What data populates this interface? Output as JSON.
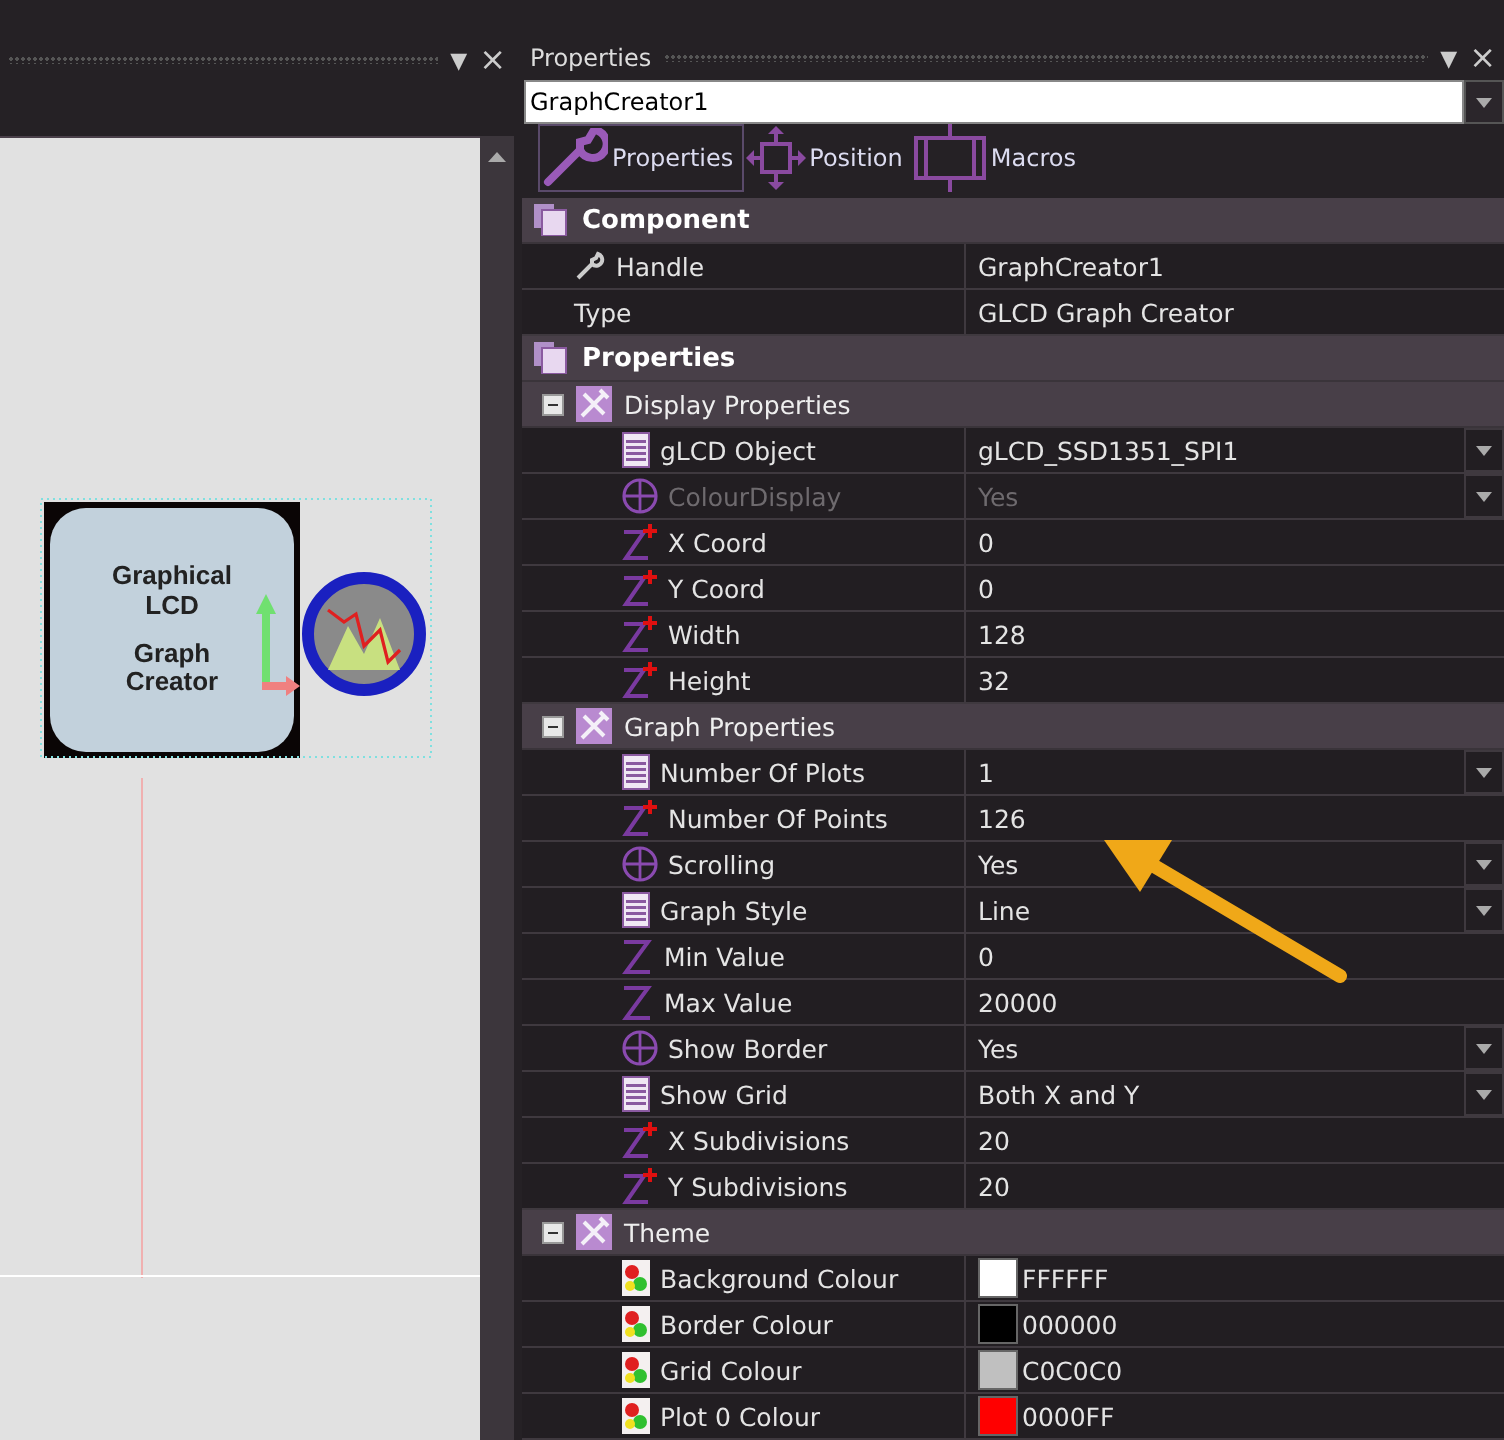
{
  "canvas": {
    "panel_controls": {
      "menu": "▼",
      "close": "×"
    },
    "component": {
      "line_1": "Graphical",
      "line_2": "LCD",
      "line_3": "Graph",
      "line_4": "Creator"
    }
  },
  "properties_panel": {
    "title": "Properties",
    "panel_controls": {
      "menu": "▼",
      "close": "×"
    },
    "selector": {
      "value": "GraphCreator1"
    },
    "tabs": [
      {
        "label": "Properties",
        "kind": "wrench",
        "selected": true
      },
      {
        "label": "Position",
        "kind": "move",
        "selected": false
      },
      {
        "label": "Macros",
        "kind": "macro",
        "selected": false
      }
    ],
    "sections": [
      {
        "title": "Component",
        "rows": [
          {
            "label": "Handle",
            "value": "GraphCreator1",
            "kind": "wrench",
            "dropdown": false,
            "disabled": false
          },
          {
            "label": "Type",
            "value": "GLCD Graph Creator",
            "kind": "none",
            "dropdown": false,
            "disabled": false
          }
        ]
      },
      {
        "title": "Properties",
        "groups": [
          {
            "title": "Display Properties",
            "expanded": true,
            "rows": [
              {
                "label": "gLCD Object",
                "value": "gLCD_SSD1351_SPI1",
                "kind": "list",
                "dropdown": true,
                "disabled": false
              },
              {
                "label": "ColourDisplay",
                "value": "Yes",
                "kind": "option",
                "dropdown": true,
                "disabled": true
              },
              {
                "label": "X Coord",
                "value": "0",
                "kind": "integer",
                "dropdown": false,
                "disabled": false
              },
              {
                "label": "Y Coord",
                "value": "0",
                "kind": "integer",
                "dropdown": false,
                "disabled": false
              },
              {
                "label": "Width",
                "value": "128",
                "kind": "integer",
                "dropdown": false,
                "disabled": false
              },
              {
                "label": "Height",
                "value": "32",
                "kind": "integer",
                "dropdown": false,
                "disabled": false
              }
            ]
          },
          {
            "title": "Graph Properties",
            "expanded": true,
            "rows": [
              {
                "label": "Number Of Plots",
                "value": "1",
                "kind": "list",
                "dropdown": true,
                "disabled": false
              },
              {
                "label": "Number Of Points",
                "value": "126",
                "kind": "integer",
                "dropdown": false,
                "disabled": false
              },
              {
                "label": "Scrolling",
                "value": "Yes",
                "kind": "option",
                "dropdown": true,
                "disabled": false
              },
              {
                "label": "Graph Style",
                "value": "Line",
                "kind": "list",
                "dropdown": true,
                "disabled": false
              },
              {
                "label": "Min Value",
                "value": "0",
                "kind": "number",
                "dropdown": false,
                "disabled": false
              },
              {
                "label": "Max Value",
                "value": "20000",
                "kind": "number",
                "dropdown": false,
                "disabled": false
              },
              {
                "label": "Show Border",
                "value": "Yes",
                "kind": "option",
                "dropdown": true,
                "disabled": false
              },
              {
                "label": "Show Grid",
                "value": "Both X and Y",
                "kind": "list",
                "dropdown": true,
                "disabled": false
              },
              {
                "label": "X Subdivisions",
                "value": "20",
                "kind": "integer",
                "dropdown": false,
                "disabled": false
              },
              {
                "label": "Y Subdivisions",
                "value": "20",
                "kind": "integer",
                "dropdown": false,
                "disabled": false
              }
            ]
          },
          {
            "title": "Theme",
            "expanded": true,
            "rows": [
              {
                "label": "Background Colour",
                "value": "FFFFFF",
                "kind": "colour",
                "color": "#ffffff",
                "dropdown": false,
                "disabled": false
              },
              {
                "label": "Border Colour",
                "value": "000000",
                "kind": "colour",
                "color": "#000000",
                "dropdown": false,
                "disabled": false
              },
              {
                "label": "Grid Colour",
                "value": "C0C0C0",
                "kind": "colour",
                "color": "#c0c0c0",
                "dropdown": false,
                "disabled": false
              },
              {
                "label": "Plot 0 Colour",
                "value": "0000FF",
                "kind": "colour",
                "color": "#ff0000",
                "dropdown": false,
                "disabled": false
              }
            ]
          }
        ]
      }
    ]
  }
}
